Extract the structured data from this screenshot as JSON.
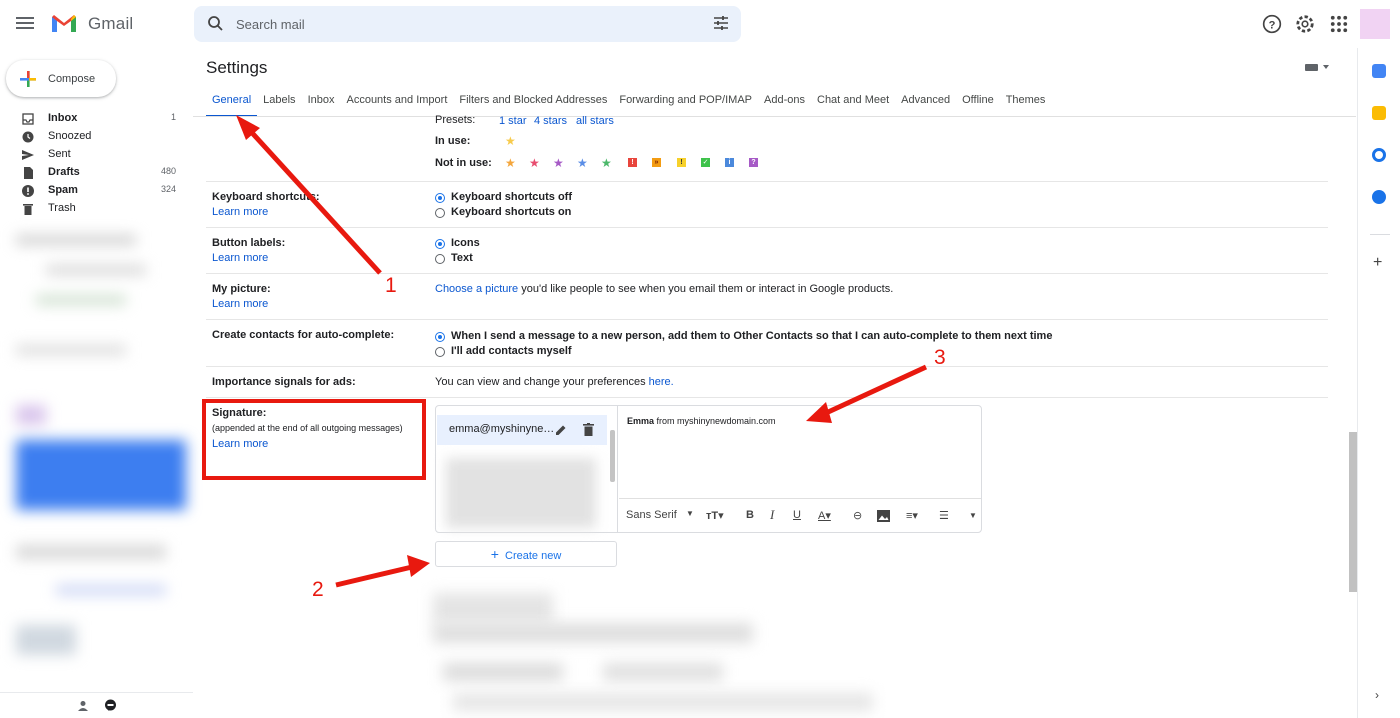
{
  "app": {
    "brand": "Gmail"
  },
  "search": {
    "placeholder": "Search mail"
  },
  "compose": {
    "label": "Compose"
  },
  "nav": {
    "items": [
      {
        "label": "Inbox",
        "count": "1",
        "bold": true
      },
      {
        "label": "Snoozed",
        "count": ""
      },
      {
        "label": "Sent",
        "count": ""
      },
      {
        "label": "Drafts",
        "count": "480",
        "bold": true
      },
      {
        "label": "Spam",
        "count": "324",
        "bold": true
      },
      {
        "label": "Trash",
        "count": ""
      }
    ]
  },
  "settings": {
    "title": "Settings",
    "tabs": [
      "General",
      "Labels",
      "Inbox",
      "Accounts and Import",
      "Filters and Blocked Addresses",
      "Forwarding and POP/IMAP",
      "Add-ons",
      "Chat and Meet",
      "Advanced",
      "Offline",
      "Themes"
    ],
    "stars": {
      "presets_label": "Presets:",
      "presets": [
        "1 star",
        "4 stars",
        "all stars"
      ],
      "in_use_label": "In use:",
      "not_in_use_label": "Not in use:"
    },
    "learn_more": "Learn more",
    "keyboard": {
      "label": "Keyboard shortcuts:",
      "opt_off": "Keyboard shortcuts off",
      "opt_on": "Keyboard shortcuts on"
    },
    "button_labels": {
      "label": "Button labels:",
      "opt_icons": "Icons",
      "opt_text": "Text"
    },
    "picture": {
      "label": "My picture:",
      "link": "Choose a picture",
      "text": " you'd like people to see when you email them or interact in Google products."
    },
    "contacts": {
      "label": "Create contacts for auto-complete:",
      "opt_auto": "When I send a message to a new person, add them to Other Contacts so that I can auto-complete to them next time",
      "opt_manual": "I'll add contacts myself"
    },
    "importance": {
      "label": "Importance signals for ads:",
      "text": "You can view and change your preferences ",
      "link": "here."
    },
    "signature": {
      "label": "Signature:",
      "sublabel": "(appended at the end of all outgoing messages)",
      "item_name": "emma@myshinyne…",
      "body_name": "Emma",
      "body_rest": " from myshinynewdomain.com",
      "font": "Sans Serif",
      "create_new": "Create new"
    }
  },
  "annotations": {
    "one": "1",
    "two": "2",
    "three": "3"
  },
  "colors": {
    "accent": "#0b57d0",
    "annotation": "#e8190f"
  }
}
